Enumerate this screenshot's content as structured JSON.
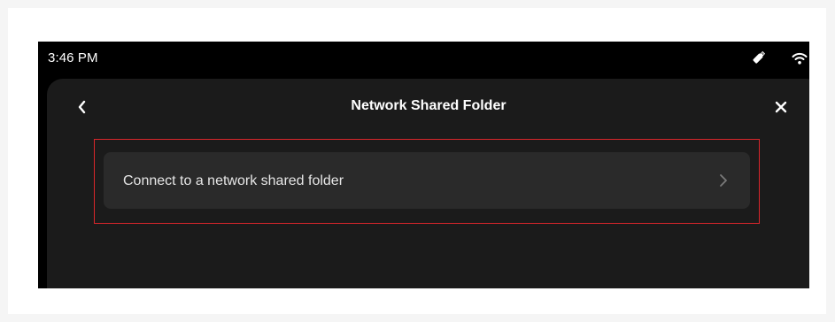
{
  "status_bar": {
    "time": "3:46 PM",
    "usb_icon": "usb-icon",
    "wifi_icon": "wifi-icon"
  },
  "panel": {
    "title": "Network Shared Folder",
    "back_icon": "chevron-left-icon",
    "close_icon": "close-icon"
  },
  "list": {
    "items": [
      {
        "label": "Connect to a network shared folder",
        "icon": "chevron-right-icon"
      }
    ]
  },
  "colors": {
    "page_background": "#f5f5f5",
    "device_background": "#000000",
    "panel_background": "#1b1b1b",
    "list_item_background": "#2a2a2a",
    "highlight": "#d9262b",
    "text_primary": "#ffffff"
  }
}
